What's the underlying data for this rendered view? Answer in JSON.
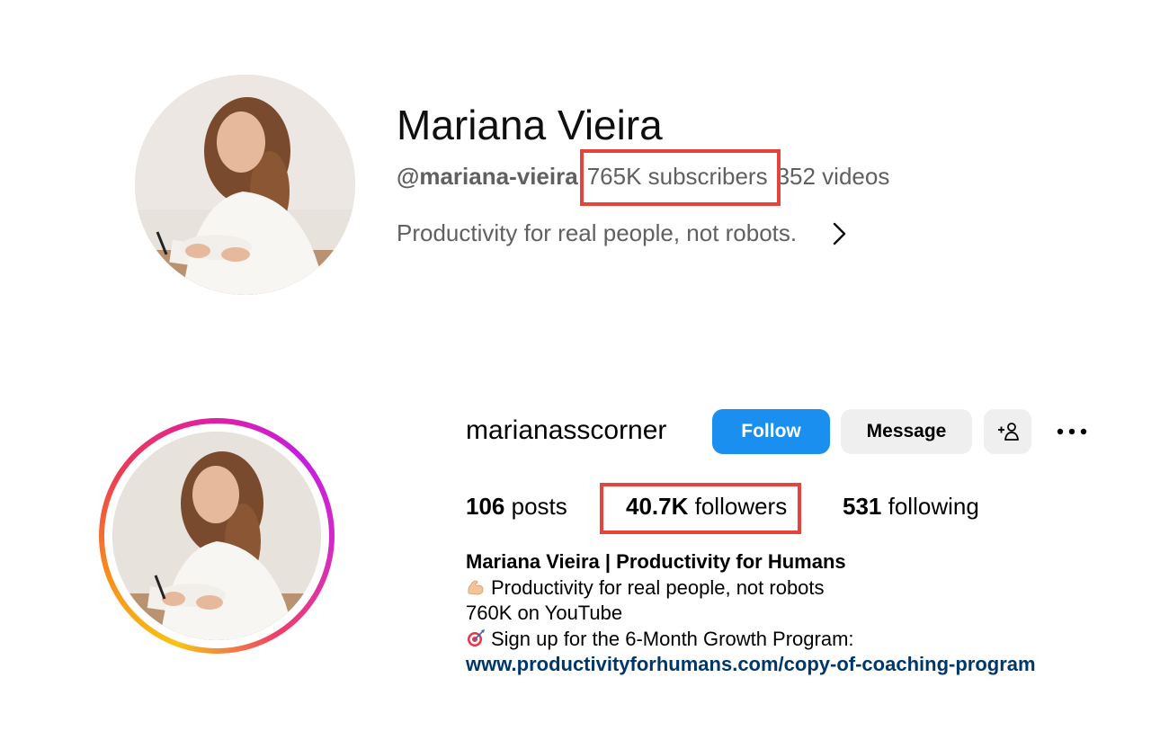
{
  "youtube": {
    "channel_name": "Mariana Vieira",
    "handle": "@mariana-vieira",
    "subscribers": "765K subscribers",
    "videos": "352 videos",
    "description": "Productivity for real people, not robots.",
    "more_icon": "chevron-right-icon"
  },
  "instagram": {
    "username": "marianasscorner",
    "follow_label": "Follow",
    "message_label": "Message",
    "add_user_icon": "add-user-icon",
    "options_icon": "more-options-icon",
    "stats": {
      "posts_count": "106",
      "posts_label": "posts",
      "followers_count": "40.7K",
      "followers_label": "followers",
      "following_count": "531",
      "following_label": "following"
    },
    "bio": {
      "name": "Mariana Vieira | Productivity for Humans",
      "line1_emoji": "flexed-biceps-emoji",
      "line1": "Productivity for real people, not robots",
      "line2": "760K on YouTube",
      "line3_emoji": "direct-hit-emoji",
      "line3": "Sign up for the 6-Month Growth Program:",
      "link": "www.productivityforhumans.com/copy-of-coaching-program"
    }
  },
  "colors": {
    "follow_button": "#1b8ff0",
    "secondary_button": "#efefef",
    "highlight_box": "#e5443c",
    "link": "#00376b",
    "muted_text": "#606060"
  }
}
